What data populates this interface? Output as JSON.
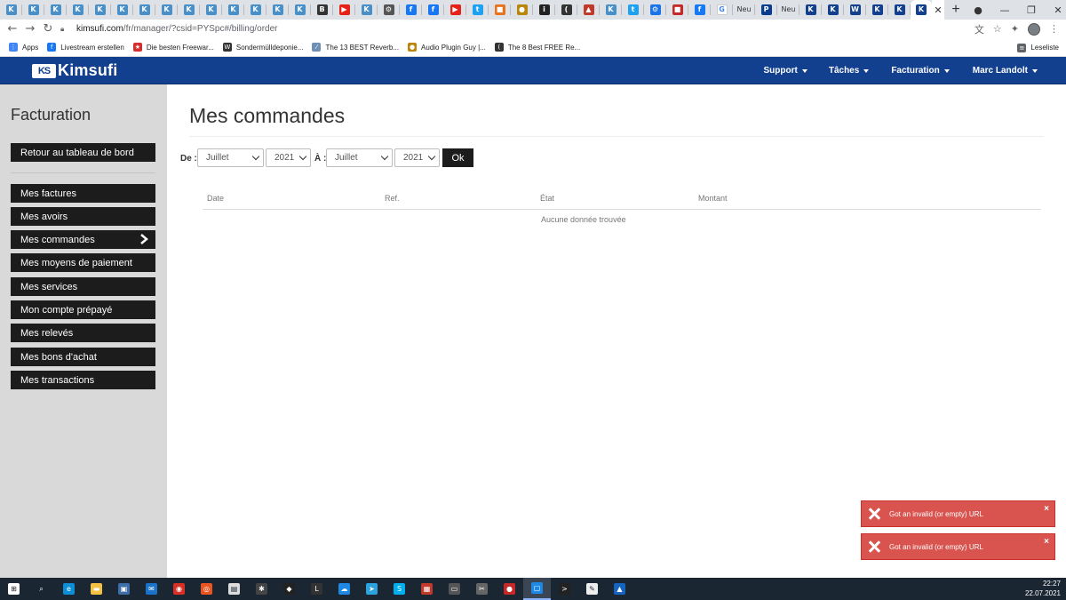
{
  "browser": {
    "tabs": [
      {
        "icon": "kimsufi-favicon-icon",
        "color": "#4a90c8",
        "glyph": "K"
      },
      {
        "icon": "kimsufi-favicon-icon",
        "color": "#4a90c8",
        "glyph": "K"
      },
      {
        "icon": "kimsufi-favicon-icon",
        "color": "#4a90c8",
        "glyph": "K"
      },
      {
        "icon": "kimsufi-favicon-icon",
        "color": "#4a90c8",
        "glyph": "K"
      },
      {
        "icon": "kimsufi-favicon-icon",
        "color": "#4a90c8",
        "glyph": "K"
      },
      {
        "icon": "kimsufi-favicon-icon",
        "color": "#4a90c8",
        "glyph": "K"
      },
      {
        "icon": "kimsufi-favicon-icon",
        "color": "#4a90c8",
        "glyph": "K"
      },
      {
        "icon": "kimsufi-favicon-icon",
        "color": "#4a90c8",
        "glyph": "K"
      },
      {
        "icon": "kimsufi-favicon-icon",
        "color": "#4a90c8",
        "glyph": "K"
      },
      {
        "icon": "kimsufi-favicon-icon",
        "color": "#4a90c8",
        "glyph": "K"
      },
      {
        "icon": "kimsufi-favicon-icon",
        "color": "#4a90c8",
        "glyph": "K"
      },
      {
        "icon": "kimsufi-favicon-icon",
        "color": "#4a90c8",
        "glyph": "K"
      },
      {
        "icon": "kimsufi-favicon-icon",
        "color": "#4a90c8",
        "glyph": "K"
      },
      {
        "icon": "kimsufi-favicon-icon",
        "color": "#4a90c8",
        "glyph": "K"
      },
      {
        "icon": "dark-app-icon",
        "color": "#333333",
        "glyph": "B"
      },
      {
        "icon": "youtube-icon",
        "color": "#e62117",
        "glyph": "▶"
      },
      {
        "icon": "kimsufi-favicon-icon",
        "color": "#4a90c8",
        "glyph": "K"
      },
      {
        "icon": "gear-link-icon",
        "color": "#555555",
        "glyph": "⚙"
      },
      {
        "icon": "facebook-icon",
        "color": "#1877f2",
        "glyph": "f"
      },
      {
        "icon": "facebook-icon",
        "color": "#1877f2",
        "glyph": "f"
      },
      {
        "icon": "youtube-icon",
        "color": "#e62117",
        "glyph": "▶"
      },
      {
        "icon": "twitter-icon",
        "color": "#1da1f2",
        "glyph": "t"
      },
      {
        "icon": "orange-app-icon",
        "color": "#e8731c",
        "glyph": "■"
      },
      {
        "icon": "plugin-guy-icon",
        "color": "#b8860b",
        "glyph": "●"
      },
      {
        "icon": "info-icon",
        "color": "#222222",
        "glyph": "i"
      },
      {
        "icon": "crescent-icon",
        "color": "#333333",
        "glyph": "("
      },
      {
        "icon": "warning-icon",
        "color": "#c0392b",
        "glyph": "▲"
      },
      {
        "icon": "kimsufi-favicon-icon",
        "color": "#4a90c8",
        "glyph": "K"
      },
      {
        "icon": "twitter-icon",
        "color": "#1da1f2",
        "glyph": "t"
      },
      {
        "icon": "settings-icon",
        "color": "#1a73e8",
        "glyph": "⚙"
      },
      {
        "icon": "red-doc-icon",
        "color": "#c62828",
        "glyph": "■"
      },
      {
        "icon": "facebook-icon",
        "color": "#1877f2",
        "glyph": "f"
      },
      {
        "icon": "google-icon",
        "color": "#ffffff",
        "glyph": "G"
      },
      {
        "icon": "new-tab-icon",
        "color": "#ffffff",
        "glyph": "Neu",
        "text": "Neu"
      },
      {
        "icon": "paypal-icon",
        "color": "#0a3d91",
        "glyph": "P"
      },
      {
        "icon": "new-tab-icon",
        "color": "#ffffff",
        "glyph": "Neu",
        "text": "Neu"
      },
      {
        "icon": "ovh-icon",
        "color": "#123f8e",
        "glyph": "K"
      },
      {
        "icon": "ovh-icon",
        "color": "#123f8e",
        "glyph": "K"
      },
      {
        "icon": "w-icon",
        "color": "#123f8e",
        "glyph": "W"
      },
      {
        "icon": "ovh-icon",
        "color": "#123f8e",
        "glyph": "K"
      },
      {
        "icon": "ovh-icon",
        "color": "#123f8e",
        "glyph": "K"
      }
    ],
    "active_tab": {
      "glyph": "K",
      "color": "#123f8e"
    },
    "new_tab_glyph": "+",
    "window_controls": [
      "●",
      "—",
      "❐",
      "✕"
    ],
    "url": {
      "host": "kimsufi.com",
      "path": "/fr/manager/?csid=PYSpc#/billing/order"
    },
    "bookmarks": [
      {
        "label": "Apps",
        "icon": "apps-grid-icon",
        "color": "#4285f4",
        "glyph": "⋮"
      },
      {
        "label": "Livestream erstellen",
        "icon": "facebook-icon",
        "color": "#1877f2",
        "glyph": "f"
      },
      {
        "label": "Die besten Freewar...",
        "icon": "star-icon",
        "color": "#d32f2f",
        "glyph": "★"
      },
      {
        "label": "Sondermülldeponie...",
        "icon": "w-icon",
        "color": "#333333",
        "glyph": "W"
      },
      {
        "label": "The 13 BEST Reverb...",
        "icon": "reverb-icon",
        "color": "#6d8fb3",
        "glyph": "⁄"
      },
      {
        "label": "Audio Plugin Guy |...",
        "icon": "plugin-guy-icon",
        "color": "#b8860b",
        "glyph": "●"
      },
      {
        "label": "The 8 Best FREE Re...",
        "icon": "crescent-icon",
        "color": "#333333",
        "glyph": "("
      }
    ],
    "reading_list": "Leseliste"
  },
  "header": {
    "logo_mark": "KS",
    "logo_text": "Kimsufi",
    "brand_color": "#123f8e",
    "nav": [
      "Support",
      "Tâches",
      "Facturation",
      "Marc Landolt"
    ]
  },
  "sidebar": {
    "title": "Facturation",
    "back_button": "Retour au tableau de bord",
    "items": [
      "Mes factures",
      "Mes avoirs",
      "Mes commandes",
      "Mes moyens de paiement",
      "Mes services",
      "Mon compte prépayé",
      "Mes relevés",
      "Mes bons d'achat",
      "Mes transactions"
    ],
    "active_index": 2
  },
  "main": {
    "title": "Mes commandes",
    "filter": {
      "from_label": "De :",
      "to_label": "À :",
      "from_month": "Juillet",
      "from_year": "2021",
      "to_month": "Juillet",
      "to_year": "2021",
      "ok_label": "Ok"
    },
    "table": {
      "columns": [
        "Date",
        "Ref.",
        "État",
        "Montant"
      ],
      "empty_message": "Aucune donnée trouvée"
    }
  },
  "notifications": [
    {
      "message": "Got an invalid (or empty) URL",
      "close": "×"
    },
    {
      "message": "Got an invalid (or empty) URL",
      "close": "×"
    }
  ],
  "taskbar": {
    "items": [
      {
        "icon": "windows-start-icon",
        "color": "#ffffff",
        "glyph": "⊞"
      },
      {
        "icon": "search-icon",
        "color": "#1b2633",
        "glyph": "⌕"
      },
      {
        "icon": "edge-icon",
        "color": "#0c8ed6",
        "glyph": "e"
      },
      {
        "icon": "file-explorer-icon",
        "color": "#f3c242",
        "glyph": "▬"
      },
      {
        "icon": "store-icon",
        "color": "#3d6ea8",
        "glyph": "▣"
      },
      {
        "icon": "mail-icon",
        "color": "#1a73c9",
        "glyph": "✉"
      },
      {
        "icon": "chrome-icon",
        "color": "#d93025",
        "glyph": "◉"
      },
      {
        "icon": "ubuntu-icon",
        "color": "#e95420",
        "glyph": "◎"
      },
      {
        "icon": "vm-icon",
        "color": "#dddddd",
        "glyph": "▤"
      },
      {
        "icon": "spider-icon",
        "color": "#444444",
        "glyph": "✱"
      },
      {
        "icon": "inkscape-icon",
        "color": "#222222",
        "glyph": "◆"
      },
      {
        "icon": "live-icon",
        "color": "#333333",
        "glyph": "L"
      },
      {
        "icon": "onedrive-icon",
        "color": "#1e88e5",
        "glyph": "☁"
      },
      {
        "icon": "telegram-icon",
        "color": "#2aa3df",
        "glyph": "➤"
      },
      {
        "icon": "skype-icon",
        "color": "#00aff0",
        "glyph": "S"
      },
      {
        "icon": "app-icon",
        "color": "#c0392b",
        "glyph": "▦"
      },
      {
        "icon": "network-icon",
        "color": "#555555",
        "glyph": "▭"
      },
      {
        "icon": "tools-icon",
        "color": "#666666",
        "glyph": "✂"
      },
      {
        "icon": "recorder-icon",
        "color": "#c62828",
        "glyph": "●"
      },
      {
        "icon": "blue-window-icon",
        "color": "#1e88e5",
        "glyph": "▢"
      },
      {
        "icon": "terminal-icon",
        "color": "#222222",
        "glyph": ">"
      },
      {
        "icon": "notepad-icon",
        "color": "#eeeeee",
        "glyph": "✎"
      },
      {
        "icon": "photo-icon",
        "color": "#1565c0",
        "glyph": "▲"
      }
    ],
    "active_index": 19,
    "time": "22:27",
    "date": "22.07.2021"
  }
}
